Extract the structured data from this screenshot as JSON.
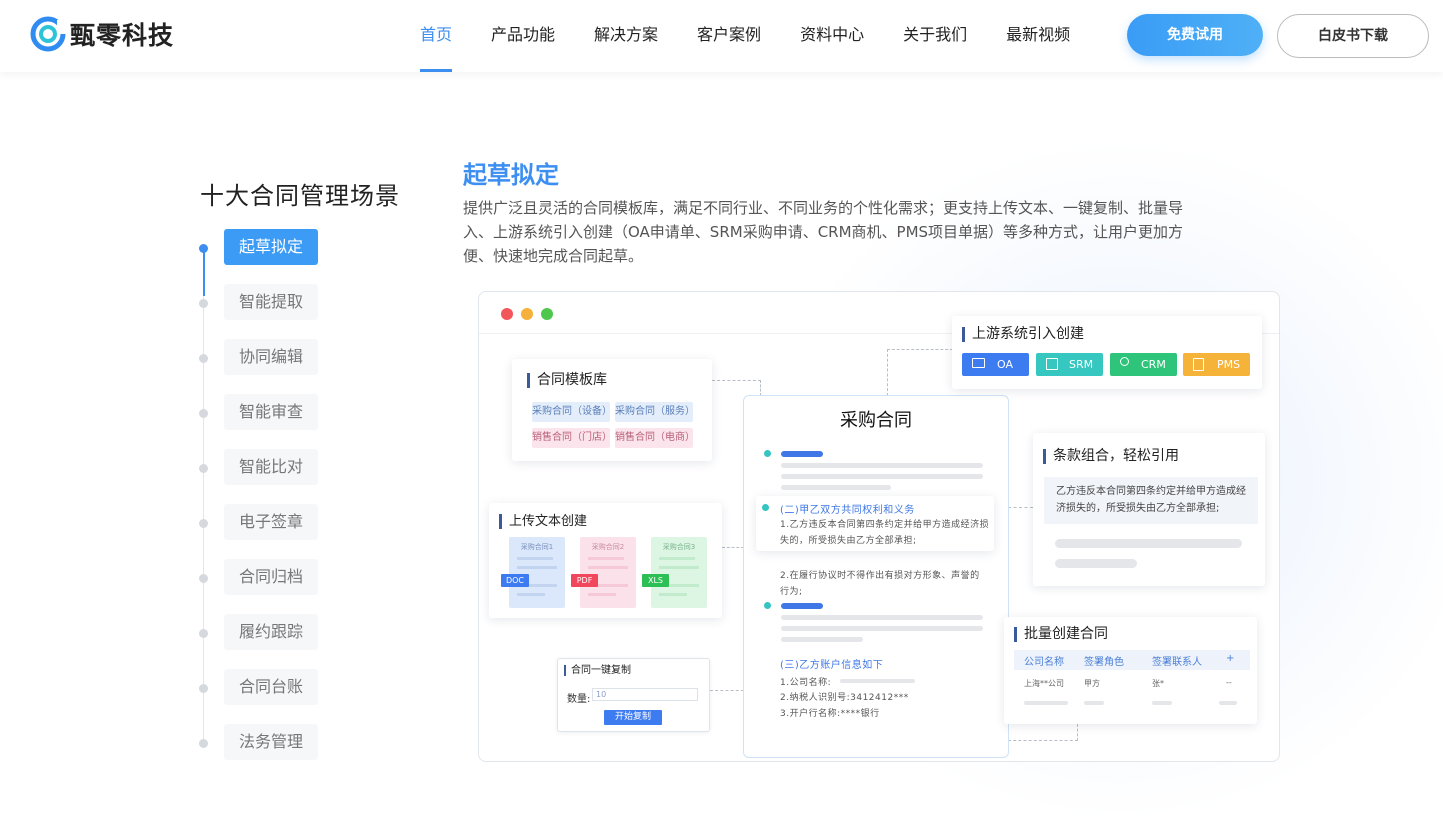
{
  "brand": {
    "name": "甄零科技"
  },
  "nav": {
    "items": [
      "首页",
      "产品功能",
      "解决方案",
      "客户案例",
      "资料中心",
      "关于我们",
      "最新视频"
    ],
    "trial_label": "免费试用",
    "whitepaper_label": "白皮书下载"
  },
  "section": {
    "title": "十大合同管理场景",
    "menu": [
      "起草拟定",
      "智能提取",
      "协同编辑",
      "智能审查",
      "智能比对",
      "电子签章",
      "合同归档",
      "履约跟踪",
      "合同台账",
      "法务管理"
    ]
  },
  "content": {
    "title": "起草拟定",
    "desc": "提供广泛且灵活的合同模板库，满足不同行业、不同业务的个性化需求；更支持上传文本、一键复制、批量导入、上游系统引入创建（OA申请单、SRM采购申请、CRM商机、PMS项目单据）等多种方式，让用户更加方便、快速地完成合同起草。"
  },
  "mockup": {
    "template_lib": {
      "title": "合同模板库",
      "tags": [
        "采购合同（设备）",
        "采购合同（服务）",
        "销售合同（门店）",
        "销售合同（电商）"
      ]
    },
    "upstream": {
      "title": "上游系统引入创建",
      "systems": [
        "OA",
        "SRM",
        "CRM",
        "PMS"
      ]
    },
    "main_doc": {
      "title": "采购合同",
      "section2": "(二)甲乙双方共同权利和义务",
      "clause1": "1.乙方违反本合同第四条约定并给甲方造成经济损失的，所受损失由乙方全部承担;",
      "clause2": "2.在履行协议时不得作出有损对方形象、声誉的行为;",
      "section3": "(三)乙方账户信息如下",
      "acct1": "1.公司名称:",
      "acct2": "2.纳税人识别号:3412412***",
      "acct3": "3.开户行名称:****银行"
    },
    "upload": {
      "title": "上传文本创建",
      "files": [
        {
          "name": "采购合同1",
          "type": "DOC"
        },
        {
          "name": "采购合同2",
          "type": "PDF"
        },
        {
          "name": "采购合同3",
          "type": "XLS"
        }
      ]
    },
    "clause": {
      "title": "条款组合，轻松引用",
      "text": "乙方违反本合同第四条约定并给甲方造成经济损失的，所受损失由乙方全部承担;"
    },
    "batch": {
      "title": "批量创建合同",
      "headers": [
        "公司名称",
        "签署角色",
        "签署联系人",
        "+"
      ],
      "row": [
        "上海**公司",
        "甲方",
        "张*",
        "--"
      ]
    },
    "copy": {
      "title": "合同一键复制",
      "qty_label": "数量:",
      "qty_value": "10",
      "button": "开始复制"
    }
  },
  "colors": {
    "accent": "#3c8ef0",
    "oa": "#3d7bf0",
    "srm": "#35c7c0",
    "crm": "#2ec47a",
    "pms": "#f5b33a"
  }
}
